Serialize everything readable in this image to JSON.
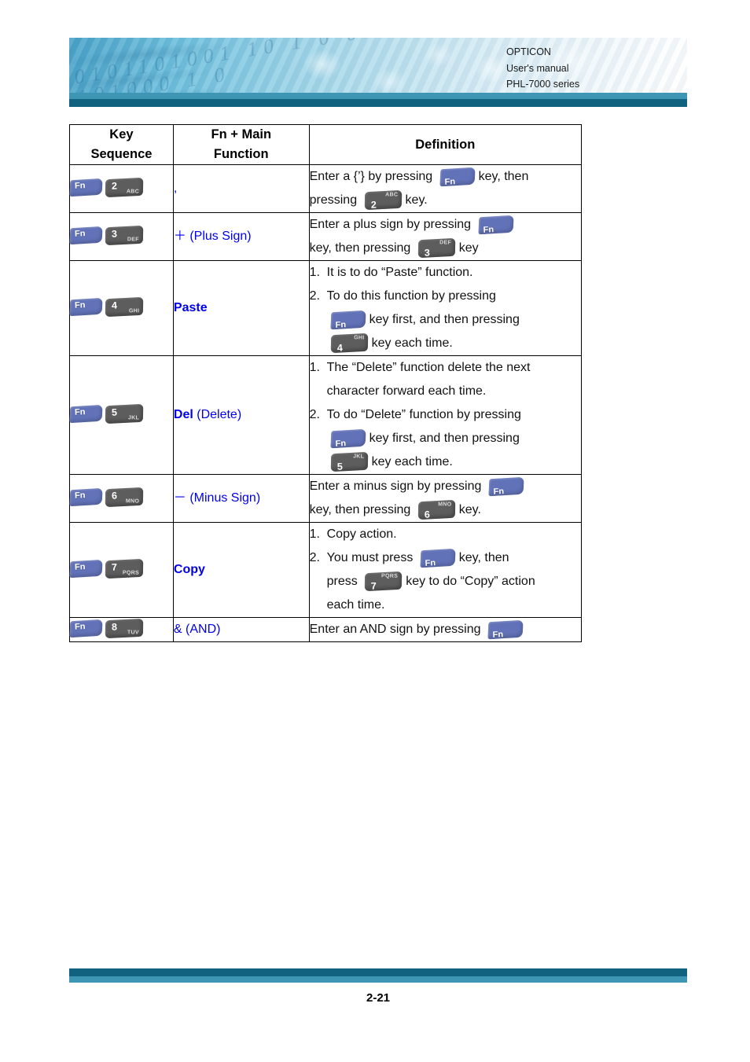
{
  "header": {
    "brand": "OPTICON",
    "line2": "User's manual",
    "line3": "PHL-7000 series"
  },
  "table": {
    "columns": [
      "Key\nSequence",
      "Fn + Main\nFunction",
      "Definition"
    ],
    "headers": {
      "key_sequence_line1": "Key",
      "key_sequence_line2": "Sequence",
      "fn_main_line1": "Fn + Main",
      "fn_main_line2": "Function",
      "definition": "Definition"
    },
    "rows": [
      {
        "keys": [
          {
            "type": "fn",
            "label": "Fn"
          },
          {
            "type": "num",
            "num": "2",
            "sub": "ABC"
          }
        ],
        "function_bold": "",
        "function_text": ",",
        "definition": {
          "numbered": false,
          "parts": [
            {
              "kind": "text",
              "value": "Enter a {’} by pressing"
            },
            {
              "kind": "key",
              "type": "fn",
              "label": "Fn"
            },
            {
              "kind": "text",
              "value": "key, then"
            },
            {
              "kind": "break"
            },
            {
              "kind": "text",
              "value": "pressing"
            },
            {
              "kind": "key",
              "type": "num",
              "num": "2",
              "sub": "ABC"
            },
            {
              "kind": "text",
              "value": "key."
            }
          ]
        }
      },
      {
        "keys": [
          {
            "type": "fn",
            "label": "Fn"
          },
          {
            "type": "num",
            "num": "3",
            "sub": "DEF"
          }
        ],
        "function_bold": "",
        "function_text": "＋  (Plus Sign)",
        "definition": {
          "numbered": false,
          "parts": [
            {
              "kind": "text",
              "value": "Enter a plus sign by pressing"
            },
            {
              "kind": "key",
              "type": "fn",
              "label": "Fn"
            },
            {
              "kind": "break"
            },
            {
              "kind": "text",
              "value": "key, then pressing"
            },
            {
              "kind": "key",
              "type": "num",
              "num": "3",
              "sub": "DEF"
            },
            {
              "kind": "text",
              "value": "key"
            }
          ]
        }
      },
      {
        "keys": [
          {
            "type": "fn",
            "label": "Fn"
          },
          {
            "type": "num",
            "num": "4",
            "sub": "GHI"
          }
        ],
        "function_bold": "Paste",
        "function_text": "",
        "definition": {
          "numbered": true,
          "items": [
            {
              "n": "1.",
              "text": "It is to do “Paste” function."
            },
            {
              "n": "2.",
              "text": "To do this function by pressing"
            }
          ],
          "tail": [
            {
              "kind": "key",
              "type": "fn",
              "label": "Fn"
            },
            {
              "kind": "text",
              "value": "key first, and then pressing"
            },
            {
              "kind": "break"
            },
            {
              "kind": "key",
              "type": "num",
              "num": "4",
              "sub": "GHI"
            },
            {
              "kind": "text",
              "value": "key each time."
            }
          ]
        }
      },
      {
        "keys": [
          {
            "type": "fn",
            "label": "Fn"
          },
          {
            "type": "num",
            "num": "5",
            "sub": "JKL"
          }
        ],
        "function_bold": "Del",
        "function_text": " (Delete)",
        "definition": {
          "numbered": true,
          "items": [
            {
              "n": "1.",
              "text": "The “Delete” function delete the next character forward each time."
            },
            {
              "n": "2.",
              "text": "To do “Delete” function by pressing"
            }
          ],
          "tail": [
            {
              "kind": "key",
              "type": "fn",
              "label": "Fn"
            },
            {
              "kind": "text",
              "value": "key first, and then pressing"
            },
            {
              "kind": "break"
            },
            {
              "kind": "key",
              "type": "num",
              "num": "5",
              "sub": "JKL"
            },
            {
              "kind": "text",
              "value": "key each time."
            }
          ]
        }
      },
      {
        "keys": [
          {
            "type": "fn",
            "label": "Fn"
          },
          {
            "type": "num",
            "num": "6",
            "sub": "MNO"
          }
        ],
        "function_bold": "",
        "function_text": "－  (Minus Sign)",
        "definition": {
          "numbered": false,
          "parts": [
            {
              "kind": "text",
              "value": "Enter a minus sign by pressing"
            },
            {
              "kind": "key",
              "type": "fn",
              "label": "Fn"
            },
            {
              "kind": "break"
            },
            {
              "kind": "text",
              "value": "key, then pressing"
            },
            {
              "kind": "key",
              "type": "num",
              "num": "6",
              "sub": "MNO"
            },
            {
              "kind": "text",
              "value": "key."
            }
          ]
        }
      },
      {
        "keys": [
          {
            "type": "fn",
            "label": "Fn"
          },
          {
            "type": "num",
            "num": "7",
            "sub": "PQRS"
          }
        ],
        "function_bold": "Copy",
        "function_text": "",
        "definition": {
          "numbered": true,
          "items": [
            {
              "n": "1.",
              "text": "Copy action."
            },
            {
              "n": "2.",
              "text": "You must press"
            }
          ],
          "tail": [],
          "inline2": [
            {
              "kind": "key",
              "type": "fn",
              "label": "Fn"
            },
            {
              "kind": "text",
              "value": "key, then"
            }
          ],
          "tail2": [
            {
              "kind": "text",
              "value": "press"
            },
            {
              "kind": "key",
              "type": "num",
              "num": "7",
              "sub": "PQRS"
            },
            {
              "kind": "text",
              "value": "key to do “Copy” action"
            },
            {
              "kind": "break"
            },
            {
              "kind": "text",
              "value": "each time."
            }
          ]
        }
      },
      {
        "keys": [
          {
            "type": "fn",
            "label": "Fn"
          },
          {
            "type": "num",
            "num": "8",
            "sub": "TUV"
          }
        ],
        "function_bold": "",
        "function_text": "&  (AND)",
        "definition": {
          "numbered": false,
          "parts": [
            {
              "kind": "text",
              "value": "Enter an AND sign by pressing"
            },
            {
              "kind": "key",
              "type": "fn",
              "label": "Fn"
            }
          ]
        }
      }
    ]
  },
  "footer": {
    "page_number": "2-21"
  },
  "colors": {
    "link_blue": "#0000ee",
    "bar_dark": "#10627f",
    "bar_light": "#3d96b4",
    "key_fn": "#6272b8",
    "key_num": "#5d5d5d"
  }
}
